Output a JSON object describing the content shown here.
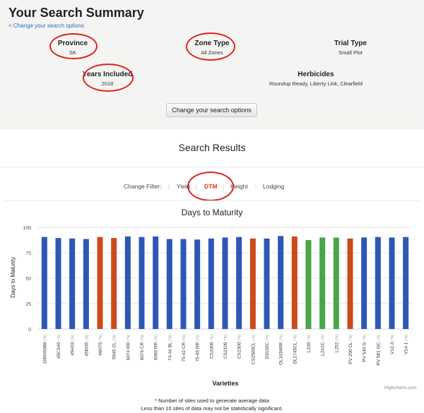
{
  "summary": {
    "title": "Your Search Summary",
    "change_link": "< Change your search options",
    "province": {
      "label": "Province",
      "value": "SK"
    },
    "zone_type": {
      "label": "Zone Type",
      "value": "All Zones"
    },
    "trial_type": {
      "label": "Trial Type",
      "value": "Small Plot"
    },
    "years_included": {
      "label": "Years Included",
      "value": "2018"
    },
    "herbicides": {
      "label": "Herbicides",
      "value": "Roundup Ready, Liberty Link, Clearfield"
    },
    "change_button": "Change your search options"
  },
  "results": {
    "title": "Search Results",
    "filter_label": "Change Filter:",
    "filters": [
      "Yield",
      "DTM",
      "Height",
      "Lodging"
    ],
    "active_filter": "DTM",
    "separator": "|"
  },
  "colors": {
    "highlight_ring": "#e02020",
    "bar_blue": "#2e56b5",
    "bar_orange": "#cc4a1c",
    "bar_green": "#4aa547",
    "active_filter": "#e03a1a",
    "link": "#2a6ebb"
  },
  "chart_data": {
    "type": "bar",
    "title": "Days to Maturity",
    "xlabel": "Varieties",
    "ylabel": "Days to Maturity",
    "ylim": [
      0,
      100
    ],
    "yticks": [
      0,
      25,
      50,
      75,
      100
    ],
    "grid": true,
    "credit": "Highcharts.com",
    "categories": [
      "16RH5088",
      "45CS40",
      "45H33",
      "45M35",
      "46H75",
      "5545 CL",
      "6074 RR",
      "6076 CR",
      "6090 RR",
      "74-44 BL",
      "75-42 CR",
      "75-65 RR",
      "CS2000",
      "CS2100",
      "CS2300",
      "CS2500CL",
      "D3155C",
      "DL1634RR",
      "DL1745CL",
      "L230",
      "L241C",
      "L252",
      "PV 200 CL",
      "PV 540 G",
      "PV 581 GC",
      "V12-3",
      "V14-1"
    ],
    "category_suffix": "(*6)",
    "values": [
      90.5,
      89.5,
      89,
      88.5,
      90.5,
      89.5,
      91,
      90.5,
      91,
      88.5,
      88.5,
      88,
      89,
      90,
      90.5,
      89,
      89,
      91.5,
      91,
      87.5,
      90,
      90,
      89,
      90,
      90.5,
      90,
      90.5
    ],
    "bar_colors": [
      "blue",
      "blue",
      "blue",
      "blue",
      "orange",
      "orange",
      "blue",
      "blue",
      "blue",
      "blue",
      "blue",
      "blue",
      "blue",
      "blue",
      "blue",
      "orange",
      "blue",
      "blue",
      "orange",
      "green",
      "green",
      "green",
      "orange",
      "blue",
      "blue",
      "blue",
      "blue"
    ]
  },
  "footnotes": {
    "line1": "* Number of sites used to generate average data",
    "line2": "Less than 10 sites of data may not be statistically significant."
  }
}
